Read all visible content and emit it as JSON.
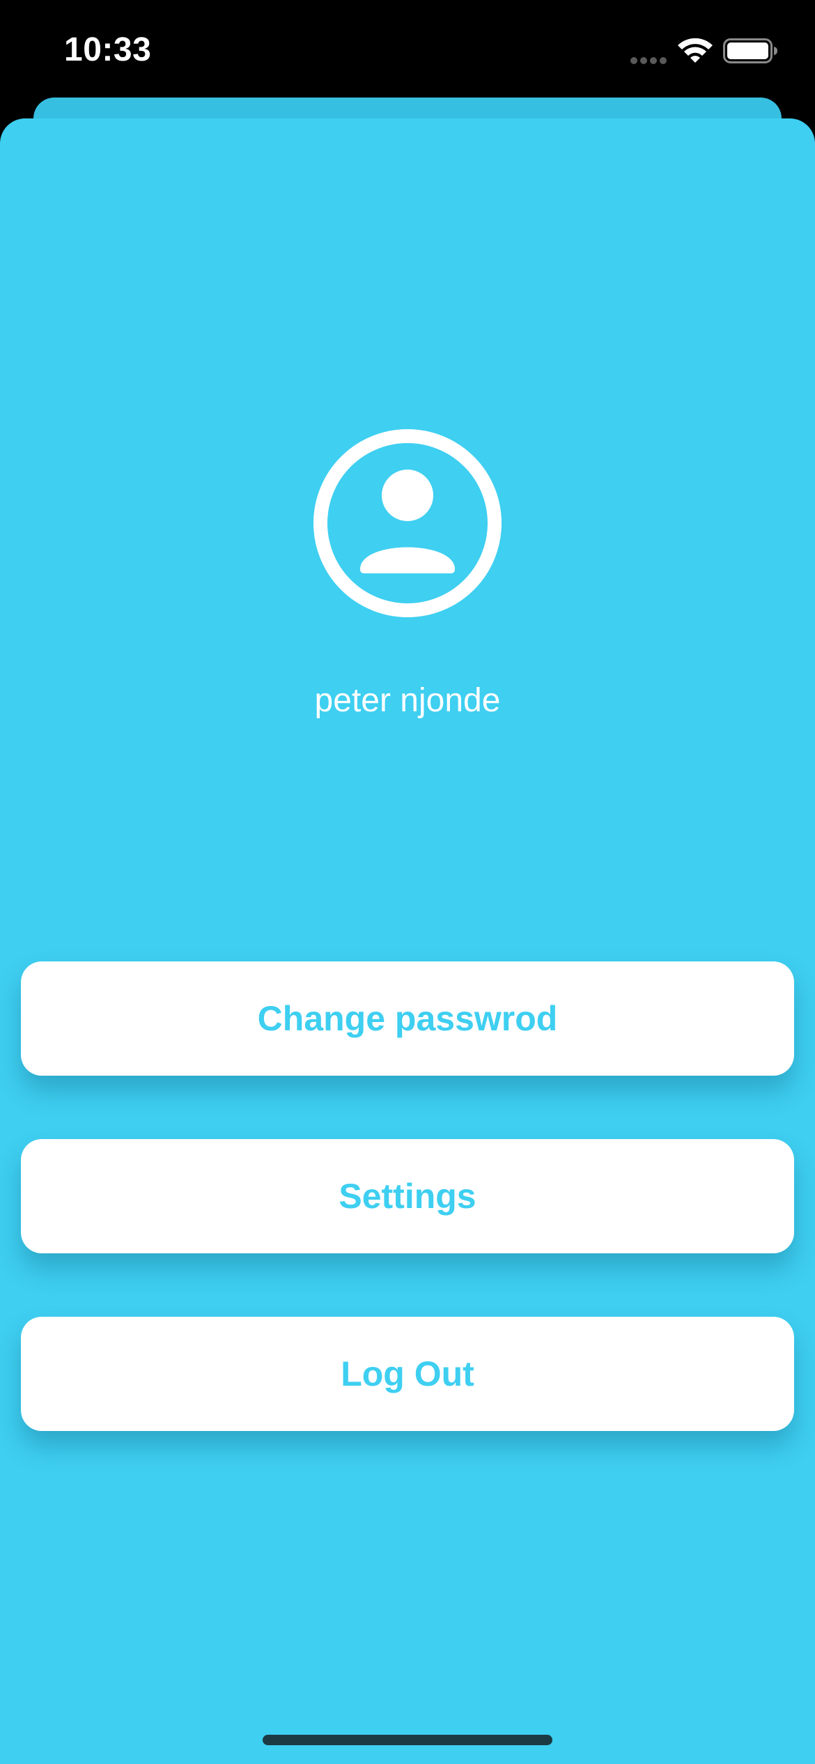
{
  "status_bar": {
    "time": "10:33"
  },
  "profile": {
    "name": "peter njonde",
    "avatar_icon": "person-circle-icon"
  },
  "actions": {
    "change_password_label": "Change passwrod",
    "settings_label": "Settings",
    "log_out_label": "Log Out"
  },
  "colors": {
    "background": "#3ecff1",
    "button_bg": "#ffffff",
    "button_text": "#3ecff1",
    "status_bar_bg": "#000000"
  }
}
